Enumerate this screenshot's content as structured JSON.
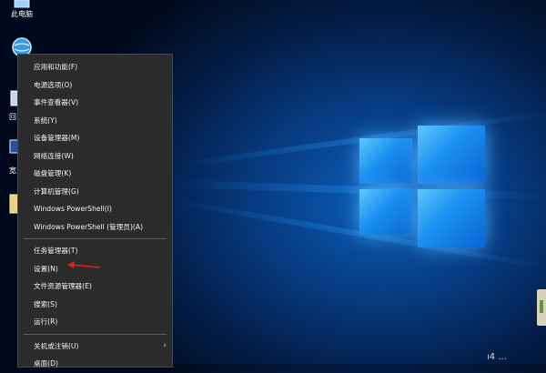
{
  "desktop": {
    "icons": [
      {
        "label": "此电脑",
        "icon": "computer-icon"
      },
      {
        "label": "",
        "icon": "network-globe-icon"
      },
      {
        "label": "回",
        "icon": "recycle-bin-icon"
      },
      {
        "label": "宽",
        "icon": "broadband-icon"
      },
      {
        "label": "",
        "icon": "folder-icon"
      }
    ],
    "edge_text": "ı4 ..."
  },
  "context_menu": {
    "groups": [
      [
        {
          "label": "应用和功能(F)"
        },
        {
          "label": "电源选项(O)"
        },
        {
          "label": "事件查看器(V)"
        },
        {
          "label": "系统(Y)"
        },
        {
          "label": "设备管理器(M)"
        },
        {
          "label": "网络连接(W)"
        },
        {
          "label": "磁盘管理(K)"
        },
        {
          "label": "计算机管理(G)"
        },
        {
          "label": "Windows PowerShell(I)"
        },
        {
          "label": "Windows PowerShell (管理员)(A)"
        }
      ],
      [
        {
          "label": "任务管理器(T)"
        },
        {
          "label": "设置(N)"
        },
        {
          "label": "文件资源管理器(E)"
        },
        {
          "label": "搜索(S)"
        },
        {
          "label": "运行(R)"
        }
      ],
      [
        {
          "label": "关机或注销(U)",
          "submenu_arrow": "›"
        },
        {
          "label": "桌面(D)"
        }
      ]
    ]
  },
  "annotation": {
    "arrow_color": "#e02020",
    "target": "设置(N)"
  }
}
